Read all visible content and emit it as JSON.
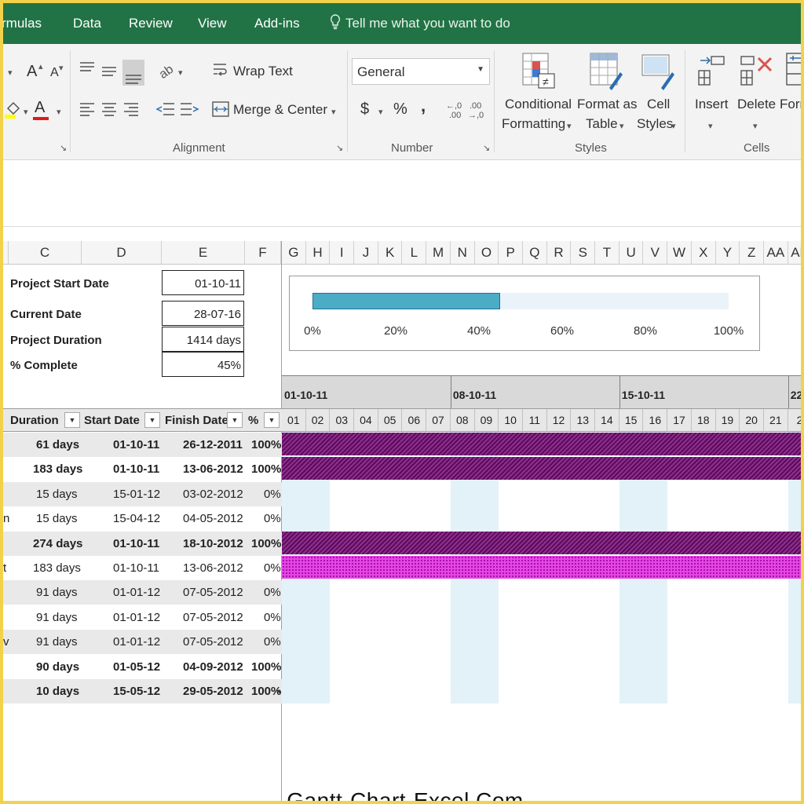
{
  "menu": {
    "items": [
      "rmulas",
      "Data",
      "Review",
      "View",
      "Add-ins"
    ],
    "tell_me": "Tell me what you want to do"
  },
  "ribbon": {
    "font_grow": "A",
    "font_shrink": "A",
    "wrap_text": "Wrap Text",
    "merge_center": "Merge & Center",
    "number_format": "General",
    "currency": "$",
    "percent": "%",
    "comma": ",",
    "conditional_formatting": [
      "Conditional",
      "Formatting"
    ],
    "format_as_table": [
      "Format as",
      "Table"
    ],
    "cell_styles": [
      "Cell",
      "Styles"
    ],
    "insert": "Insert",
    "delete": "Delete",
    "format_partial": "Form",
    "groups": {
      "alignment": "Alignment",
      "number": "Number",
      "styles": "Styles",
      "cells": "Cells"
    }
  },
  "columns": [
    "C",
    "D",
    "E",
    "F",
    "G",
    "H",
    "I",
    "J",
    "K",
    "L",
    "M",
    "N",
    "O",
    "P",
    "Q",
    "R",
    "S",
    "T",
    "U",
    "V",
    "W",
    "X",
    "Y",
    "Z",
    "AA",
    "AE"
  ],
  "info": [
    {
      "label": "Project Start Date",
      "value": "01-10-11"
    },
    {
      "label": "Current Date",
      "value": "28-07-16"
    },
    {
      "label": "Project Duration",
      "value": "1414 days"
    },
    {
      "label": "% Complete",
      "value": "45%"
    }
  ],
  "progress": {
    "fraction": 0.45,
    "ticks": [
      "0%",
      "20%",
      "40%",
      "60%",
      "80%",
      "100%"
    ],
    "fill_color": "#4bacc6"
  },
  "weeks": [
    "01-10-11",
    "08-10-11",
    "15-10-11",
    "22"
  ],
  "days": [
    "01",
    "02",
    "03",
    "04",
    "05",
    "06",
    "07",
    "08",
    "09",
    "10",
    "11",
    "12",
    "13",
    "14",
    "15",
    "16",
    "17",
    "18",
    "19",
    "20",
    "21",
    "2"
  ],
  "table_headers": {
    "duration": "Duration",
    "start": "Start Date",
    "finish": "Finish Date",
    "pct": "%"
  },
  "tasks": [
    {
      "prefix": "",
      "duration": "61 days",
      "start": "01-10-11",
      "finish": "26-12-2011",
      "pct": "100%",
      "bold": true,
      "shade": true,
      "bar": "dark"
    },
    {
      "prefix": "",
      "duration": "183 days",
      "start": "01-10-11",
      "finish": "13-06-2012",
      "pct": "100%",
      "bold": true,
      "shade": false,
      "bar": "dark"
    },
    {
      "prefix": "",
      "duration": "15 days",
      "start": "15-01-12",
      "finish": "03-02-2012",
      "pct": "0%",
      "bold": false,
      "shade": true,
      "bar": ""
    },
    {
      "prefix": "n",
      "duration": "15 days",
      "start": "15-04-12",
      "finish": "04-05-2012",
      "pct": "0%",
      "bold": false,
      "shade": false,
      "bar": ""
    },
    {
      "prefix": "",
      "duration": "274 days",
      "start": "01-10-11",
      "finish": "18-10-2012",
      "pct": "100%",
      "bold": true,
      "shade": true,
      "bar": "dark"
    },
    {
      "prefix": "t",
      "duration": "183 days",
      "start": "01-10-11",
      "finish": "13-06-2012",
      "pct": "0%",
      "bold": false,
      "shade": false,
      "bar": "pink"
    },
    {
      "prefix": "",
      "duration": "91 days",
      "start": "01-01-12",
      "finish": "07-05-2012",
      "pct": "0%",
      "bold": false,
      "shade": true,
      "bar": ""
    },
    {
      "prefix": "",
      "duration": "91 days",
      "start": "01-01-12",
      "finish": "07-05-2012",
      "pct": "0%",
      "bold": false,
      "shade": false,
      "bar": ""
    },
    {
      "prefix": "v",
      "duration": "91 days",
      "start": "01-01-12",
      "finish": "07-05-2012",
      "pct": "0%",
      "bold": false,
      "shade": true,
      "bar": ""
    },
    {
      "prefix": "",
      "duration": "90 days",
      "start": "01-05-12",
      "finish": "04-09-2012",
      "pct": "100%",
      "bold": true,
      "shade": false,
      "bar": ""
    },
    {
      "prefix": "",
      "duration": "10 days",
      "start": "15-05-12",
      "finish": "29-05-2012",
      "pct": "100%",
      "bold": true,
      "shade": true,
      "bar": ""
    }
  ],
  "colors": {
    "ribbon_green": "#217346",
    "bar_dark": "#7a1b7a",
    "bar_pink": "#e845e8",
    "weekend": "#e3f1f9"
  },
  "watermark": "Gantt-Chart-Excel.Com"
}
